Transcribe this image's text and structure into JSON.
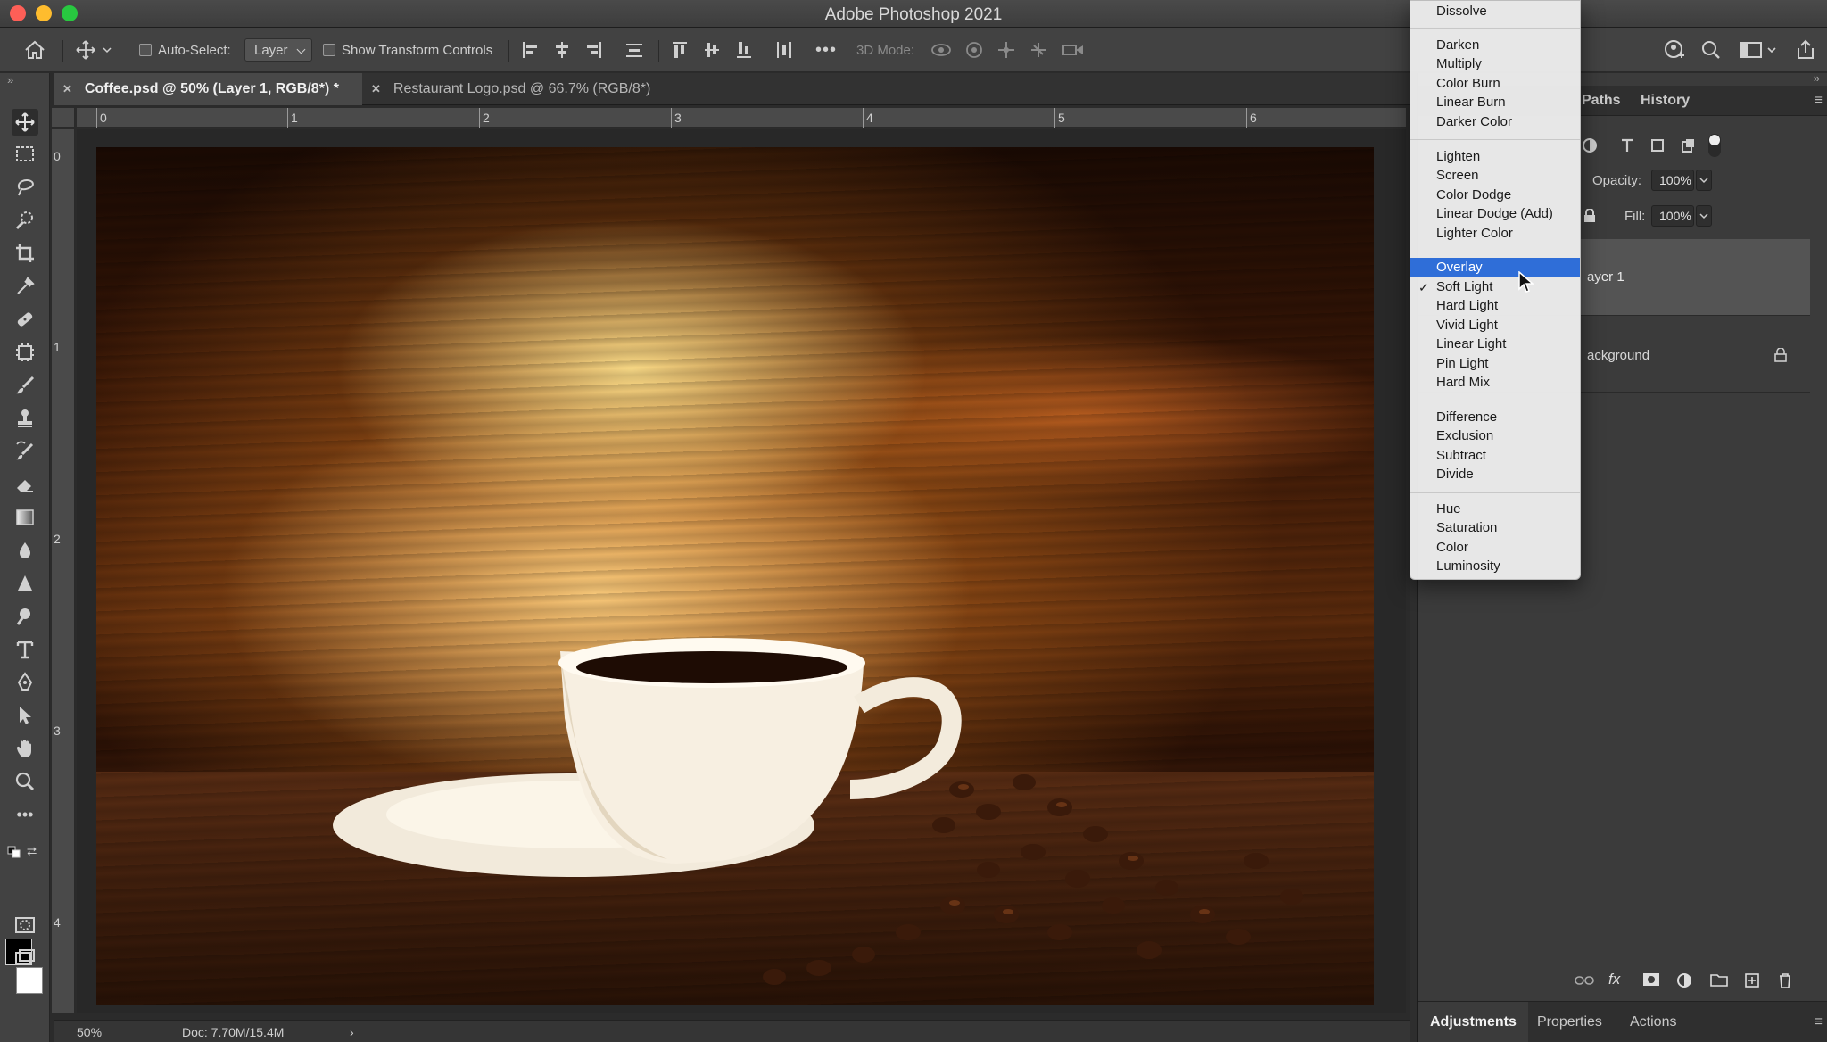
{
  "app": {
    "title": "Adobe Photoshop 2021"
  },
  "options_bar": {
    "auto_select_label": "Auto-Select:",
    "auto_select_value": "Layer",
    "show_transform_label": "Show Transform Controls",
    "three_d_mode_label": "3D Mode:"
  },
  "tabs": [
    {
      "label": "Coffee.psd @ 50% (Layer 1, RGB/8*) *",
      "active": true
    },
    {
      "label": "Restaurant Logo.psd @ 66.7% (RGB/8*)",
      "active": false
    }
  ],
  "rulers": {
    "top": [
      "0",
      "1",
      "2",
      "3",
      "4",
      "5",
      "6"
    ],
    "left": [
      "0",
      "1",
      "2",
      "3",
      "4"
    ]
  },
  "status": {
    "zoom": "50%",
    "doc": "Doc: 7.70M/15.4M",
    "arrow": "›"
  },
  "right_panel": {
    "tabs": [
      "Paths",
      "History"
    ],
    "opacity_label": "Opacity:",
    "opacity_value": "100%",
    "fill_label": "Fill:",
    "fill_value": "100%",
    "layers": [
      {
        "name_visible": "ayer 1",
        "selected": true
      },
      {
        "name_visible": "ackground",
        "locked": true
      }
    ],
    "bottom_tabs": [
      "Adjustments",
      "Properties",
      "Actions"
    ]
  },
  "blend_menu": {
    "groups": [
      [
        "Dissolve"
      ],
      [
        "Darken",
        "Multiply",
        "Color Burn",
        "Linear Burn",
        "Darker Color"
      ],
      [
        "Lighten",
        "Screen",
        "Color Dodge",
        "Linear Dodge (Add)",
        "Lighter Color"
      ],
      [
        "Overlay",
        "Soft Light",
        "Hard Light",
        "Vivid Light",
        "Linear Light",
        "Pin Light",
        "Hard Mix"
      ],
      [
        "Difference",
        "Exclusion",
        "Subtract",
        "Divide"
      ],
      [
        "Hue",
        "Saturation",
        "Color",
        "Luminosity"
      ]
    ],
    "highlighted": "Overlay",
    "checked": "Soft Light",
    "check_glyph": "✓"
  },
  "colors": {
    "menu_highlight": "#2f6ed8",
    "foreground_swatch": "#000000",
    "background_swatch": "#ffffff"
  }
}
